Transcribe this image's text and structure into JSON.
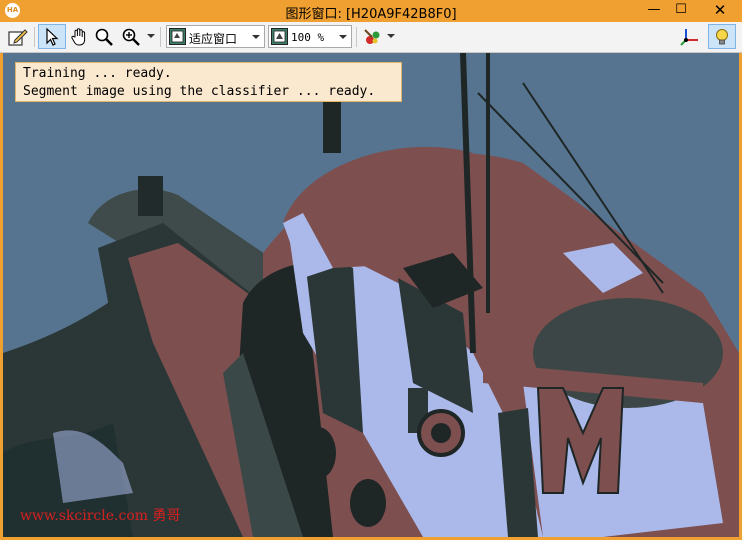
{
  "window": {
    "title": "图形窗口: [H20A9F42B8F0]",
    "app_icon_text": "HA",
    "controls": {
      "minimize": "—",
      "maximize": "☐",
      "close": "✕"
    }
  },
  "toolbar": {
    "fit_combo": {
      "value": "适应窗口"
    },
    "zoom_combo": {
      "value": "100 %"
    }
  },
  "messages": [
    "Training ... ready.",
    "Segment image using the classifier ... ready."
  ],
  "watermark": "www.skcircle.com 勇哥",
  "colors": {
    "titlebar": "#f0a030",
    "background_sky": "#56748f",
    "deck_brown": "#7e4f4f",
    "hull_dark": "#2b3636",
    "cabin_white": "#aab9e9",
    "message_bg": "#fbe9cf"
  }
}
